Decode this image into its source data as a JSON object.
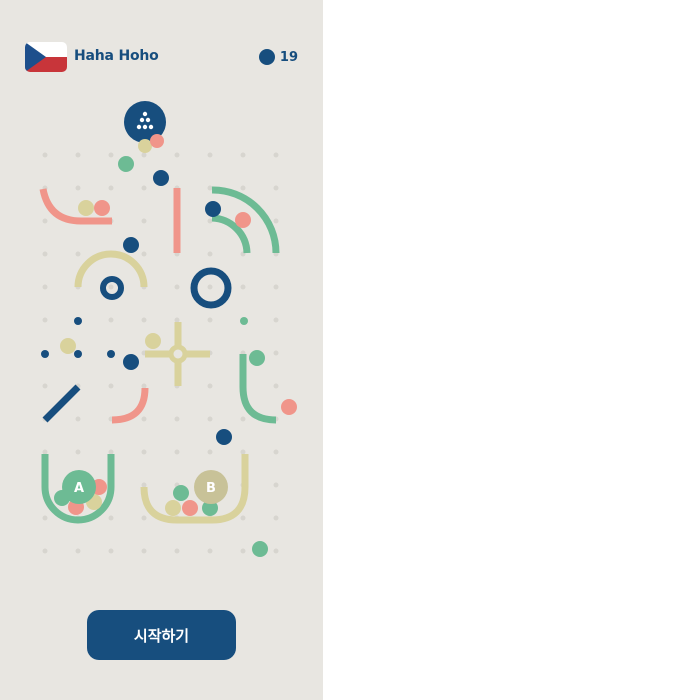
{
  "player": {
    "name": "Haha Hoho",
    "flag": "czech-flag"
  },
  "coins": {
    "count": "19",
    "icon": "coin-icon"
  },
  "board": {
    "bucket_a_label": "A",
    "bucket_b_label": "B",
    "dropper_icon": "dots-triangle-icon"
  },
  "actions": {
    "start_label": "시작하기"
  },
  "colors": {
    "background": "#e8e6e1",
    "navy": "#174e7e",
    "green": "#6dbb94",
    "salmon": "#f0958a",
    "sand": "#d9d29c"
  }
}
